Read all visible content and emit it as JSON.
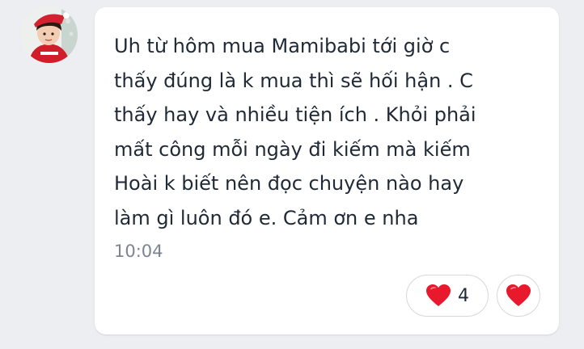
{
  "message": {
    "lines": [
      "Uh từ hôm mua Mamibabi tới giờ c",
      "thấy đúng là k mua thì sẽ hối hận . C",
      "thấy hay và nhiều tiện ích . Khỏi phải",
      "mất công mỗi ngày đi kiếm mà kiếm",
      "Hoài k biết nên đọc chuyện nào hay",
      "làm gì luôn đó e. Cảm ơn e nha"
    ],
    "timestamp": "10:04"
  },
  "reactions": {
    "heart_count": "4",
    "heart_icon": "heart-icon",
    "heart_color": "#e8192c"
  },
  "colors": {
    "background": "#eceef2",
    "bubble": "#ffffff",
    "text": "#1f2a36",
    "timestamp": "#7b8591"
  }
}
